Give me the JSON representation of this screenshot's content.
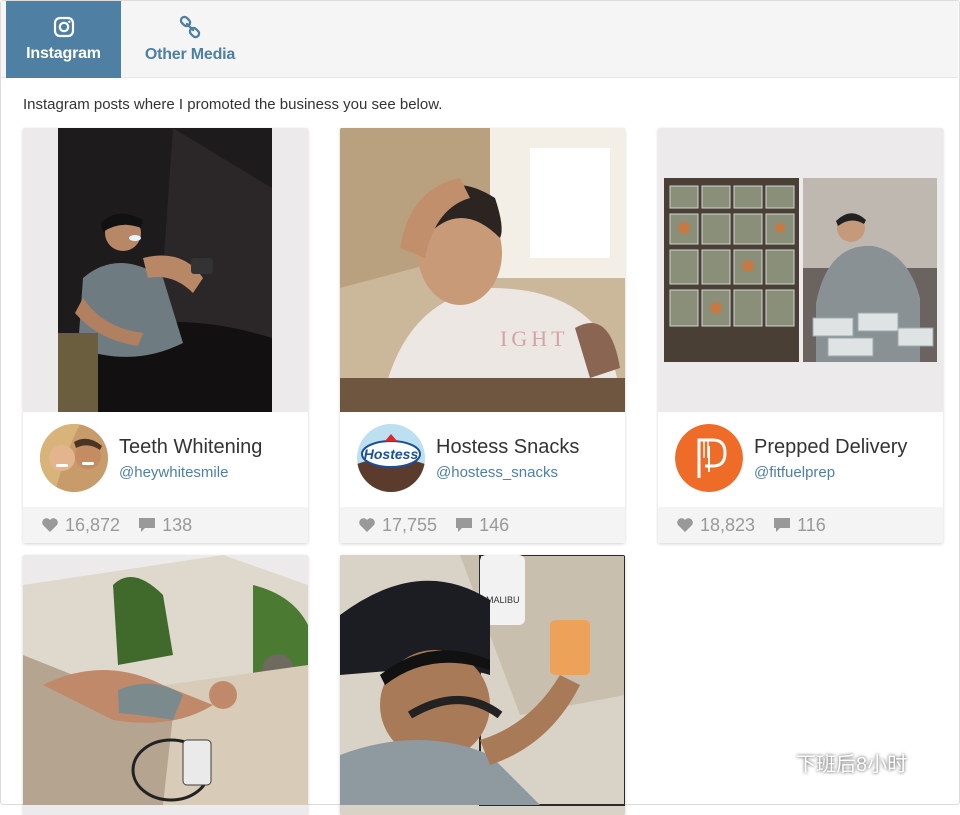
{
  "tabs": [
    {
      "label": "Instagram",
      "icon": "instagram-icon",
      "active": true
    },
    {
      "label": "Other Media",
      "icon": "link-icon",
      "active": false
    }
  ],
  "intro": "Instagram posts where I promoted the business you see below.",
  "posts": [
    {
      "business": "Teeth Whitening",
      "handle": "@heywhitesmile",
      "likes": "16,872",
      "comments": "138"
    },
    {
      "business": "Hostess Snacks",
      "handle": "@hostess_snacks",
      "likes": "17,755",
      "comments": "146",
      "avatar_text": "Hostess"
    },
    {
      "business": "Prepped Delivery",
      "handle": "@fitfuelprep",
      "likes": "18,823",
      "comments": "116"
    },
    {},
    {
      "bottle_label": "MALIBU"
    }
  ],
  "watermark": "下班后8小时",
  "colors": {
    "accent": "#4f7fa3",
    "prep_orange": "#ee6b28",
    "muted": "#999999"
  }
}
